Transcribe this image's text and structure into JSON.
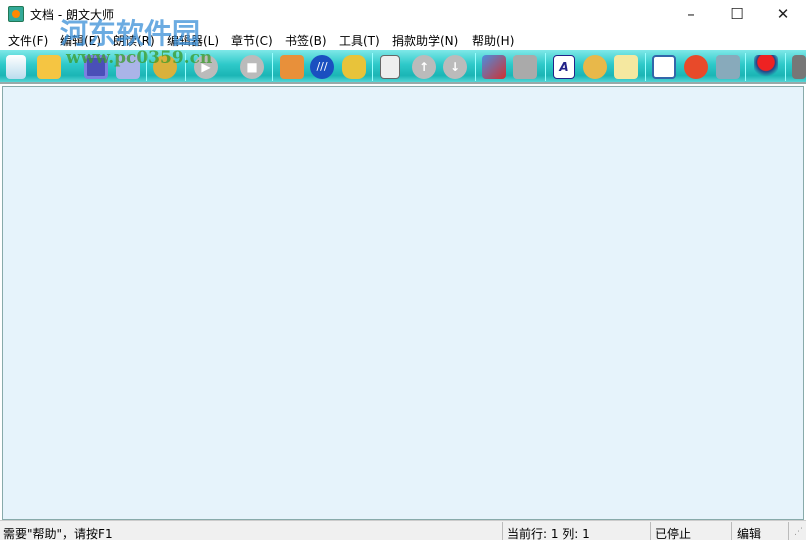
{
  "window": {
    "title": "文档 - 朗文大师",
    "minimize": "–",
    "maximize": "☐",
    "close": "✕"
  },
  "menu": [
    "文件(F)",
    "编辑(E)",
    "朗读(R)",
    "编辑器(L)",
    "章节(C)",
    "书签(B)",
    "工具(T)",
    "捐款助学(N)",
    "帮助(H)"
  ],
  "toolbar": [
    "new-icon",
    "open-icon",
    "save-icon",
    "save-as-icon",
    "find-icon",
    "play-icon",
    "stop-icon",
    "users-icon",
    "voice-icon",
    "speaker-icon",
    "list-icon",
    "up-icon",
    "down-icon",
    "book-icon",
    "import-icon",
    "font-icon",
    "palette-icon",
    "dictionary-icon",
    "video-icon",
    "alarm-icon",
    "computer-icon",
    "logo-icon",
    "tool-icon"
  ],
  "watermark": {
    "name": "河东软件园",
    "url": "www.pc0359.cn"
  },
  "status": {
    "help": "需要\"帮助\"，请按F1",
    "position": "当前行: 1  列: 1",
    "state": "已停止",
    "mode": "编辑"
  }
}
